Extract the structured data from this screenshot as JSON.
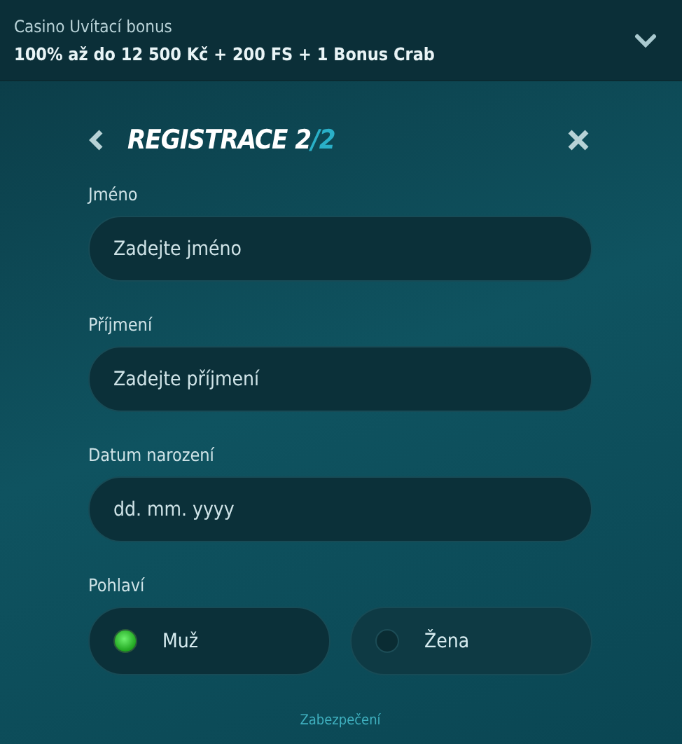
{
  "bonus": {
    "title": "Casino Uvítací bonus",
    "offer": "100% až do 12 500 Kč + 200 FS + 1 Bonus Crab",
    "expanded": false
  },
  "heading": {
    "title": "REGISTRACE 2",
    "step": "/2"
  },
  "fields": [
    {
      "label": "Jméno",
      "placeholder": "Zadejte jméno"
    },
    {
      "label": "Příjmení",
      "placeholder": "Zadejte příjmení"
    },
    {
      "label": "Datum narození",
      "placeholder": "dd. mm. yyyy"
    }
  ],
  "gender": {
    "label": "Pohlaví",
    "options": [
      {
        "label": "Muž",
        "selected": true
      },
      {
        "label": "Žena",
        "selected": false
      }
    ]
  },
  "footer_link": "Zabezpečení"
}
